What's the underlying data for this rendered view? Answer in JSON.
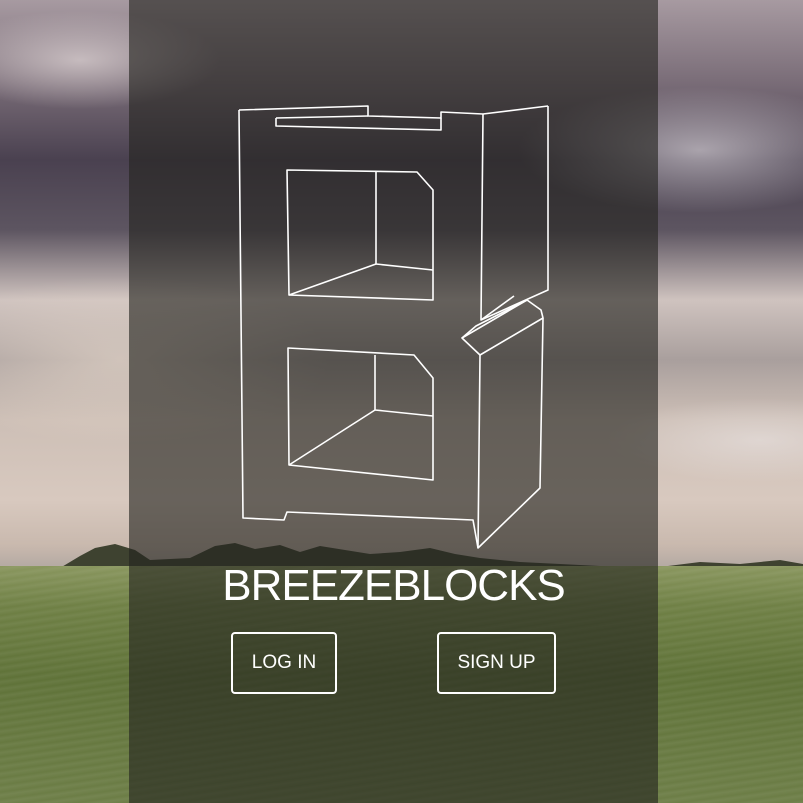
{
  "brand": {
    "name": "BREEZEBLOCKS",
    "logo_icon": "breezeblock-b-icon"
  },
  "actions": {
    "login_label": "LOG IN",
    "signup_label": "SIGN UP"
  },
  "colors": {
    "overlay": "#23231e",
    "text": "#ffffff",
    "sky": "#7b6e79",
    "grass": "#6f8045"
  }
}
